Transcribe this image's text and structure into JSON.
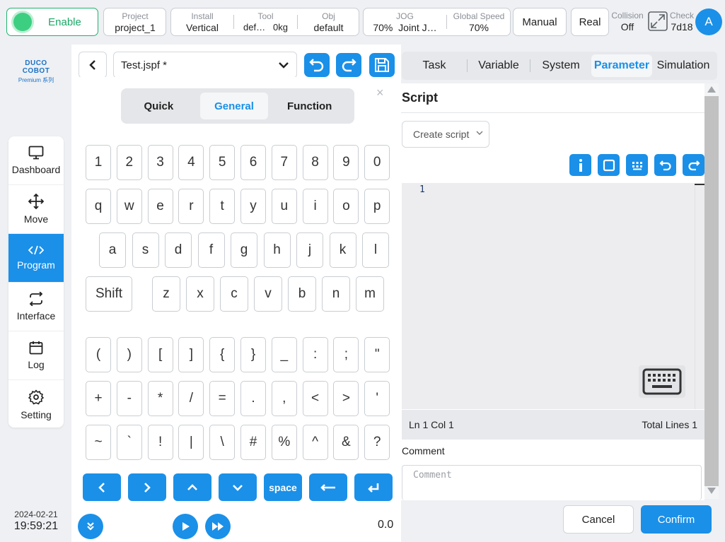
{
  "topbar": {
    "enable_label": "Enable",
    "project": {
      "key": "Project",
      "value": "project_1"
    },
    "install": {
      "key": "Install",
      "value": "Vertical"
    },
    "tool": {
      "key": "Tool",
      "name": "def…",
      "weight": "0kg"
    },
    "obj": {
      "key": "Obj",
      "value": "default"
    },
    "jog": {
      "key": "JOG",
      "percent": "70%",
      "mode": "Joint J…"
    },
    "global_speed": {
      "key": "Global Speed",
      "value": "70%"
    },
    "manual_label": "Manual",
    "real_label": "Real",
    "collision": {
      "key": "Collision",
      "value": "Off"
    },
    "check": {
      "key": "Check",
      "value": "7d18"
    },
    "avatar_letter": "A"
  },
  "logo": {
    "brand": "DUCO COBOT",
    "sub": "Premium 系列"
  },
  "nav": {
    "items": [
      {
        "label": "Dashboard",
        "icon": "monitor-icon"
      },
      {
        "label": "Move",
        "icon": "move-arrows-icon"
      },
      {
        "label": "Program",
        "icon": "code-icon"
      },
      {
        "label": "Interface",
        "icon": "swap-icon"
      },
      {
        "label": "Log",
        "icon": "calendar-icon"
      },
      {
        "label": "Setting",
        "icon": "gear-icon"
      }
    ],
    "active": "Program"
  },
  "datetime": {
    "date": "2024-02-21",
    "time": "19:59:21"
  },
  "editor_toolbar": {
    "file_name": "Test.jspf *"
  },
  "keyboard": {
    "close": "×",
    "tabs": [
      {
        "label": "Quick"
      },
      {
        "label": "General"
      },
      {
        "label": "Function"
      }
    ],
    "active_tab": "General",
    "row_digits": [
      "1",
      "2",
      "3",
      "4",
      "5",
      "6",
      "7",
      "8",
      "9",
      "0"
    ],
    "row_q": [
      "q",
      "w",
      "e",
      "r",
      "t",
      "y",
      "u",
      "i",
      "o",
      "p"
    ],
    "row_a": [
      "a",
      "s",
      "d",
      "f",
      "g",
      "h",
      "j",
      "k",
      "l"
    ],
    "shift_label": "Shift",
    "row_z": [
      "z",
      "x",
      "c",
      "v",
      "b",
      "n",
      "m"
    ],
    "row_sym1": [
      "(",
      ")",
      "[",
      "]",
      "{",
      "}",
      "_",
      ":",
      ";",
      "\""
    ],
    "row_sym2": [
      "+",
      "-",
      "*",
      "/",
      "=",
      ".",
      ",",
      "<",
      ">",
      "'"
    ],
    "row_sym3": [
      "~",
      "`",
      "!",
      "|",
      "\\",
      "#",
      "%",
      "^",
      "&",
      "?"
    ],
    "bottom_keys": [
      {
        "name": "left-arrow-key",
        "icon": "chevron-left-icon"
      },
      {
        "name": "right-arrow-key",
        "icon": "chevron-right-icon"
      },
      {
        "name": "up-arrow-key",
        "icon": "chevron-up-icon"
      },
      {
        "name": "down-arrow-key",
        "icon": "chevron-down-icon"
      },
      {
        "name": "space-key",
        "label": "space"
      },
      {
        "name": "backspace-key",
        "icon": "backspace-arrow-icon"
      },
      {
        "name": "enter-key",
        "icon": "enter-icon"
      }
    ]
  },
  "player": {
    "speed_value": "0.0"
  },
  "right_tabs": {
    "items": [
      "Task",
      "Variable",
      "System",
      "Parameter",
      "Simulation"
    ],
    "active": "Parameter"
  },
  "script_panel": {
    "title": "Script",
    "create_script_placeholder": "Create script",
    "editor_line_number": "1",
    "status_position": "Ln 1 Col 1",
    "status_total": "Total Lines 1",
    "comment_label": "Comment",
    "comment_placeholder": "Comment"
  },
  "footer": {
    "cancel_label": "Cancel",
    "confirm_label": "Confirm"
  },
  "colors": {
    "accent": "#1a90e8",
    "enable_green": "#1aa866"
  }
}
